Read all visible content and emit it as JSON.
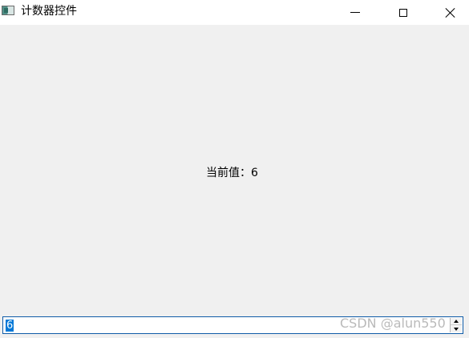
{
  "window": {
    "title": "计数器控件",
    "icon": "app-window-icon",
    "controls": {
      "minimize_icon": "minimize-icon",
      "maximize_icon": "maximize-icon",
      "close_icon": "close-icon"
    }
  },
  "main": {
    "current_value_text": "当前值：6"
  },
  "spinbox": {
    "value": "6",
    "up_icon": "arrow-up-icon",
    "down_icon": "arrow-down-icon"
  },
  "watermark": {
    "text": "CSDN @alun550"
  },
  "colors": {
    "window_bg": "#f0f0f0",
    "titlebar_bg": "#ffffff",
    "selection": "#0078d7",
    "focus_border": "#0f5ba7"
  }
}
